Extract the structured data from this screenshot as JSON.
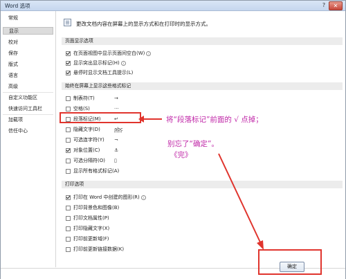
{
  "window": {
    "title": "Word 选项",
    "help_label": "?",
    "close_label": "✕"
  },
  "nav": {
    "items": [
      {
        "label": "常规"
      },
      {
        "label": "显示",
        "selected": true
      },
      {
        "label": "校对"
      },
      {
        "label": "保存"
      },
      {
        "label": "版式"
      },
      {
        "label": "语言"
      },
      {
        "label": "高级"
      },
      {
        "label": "自定义功能区"
      },
      {
        "label": "快速访问工具栏"
      },
      {
        "label": "加载项"
      },
      {
        "label": "信任中心"
      }
    ]
  },
  "main": {
    "header_icon": "document-display-icon",
    "description": "更改文档内容在屏幕上的显示方式和在打印时的显示方式。",
    "sections": {
      "page_display": {
        "title": "页面显示选项",
        "options": [
          {
            "label": "在页面视图中显示页面间空白(W)",
            "checked": true,
            "info": true
          },
          {
            "label": "显示突出显示标记(H)",
            "checked": true,
            "info": true
          },
          {
            "label": "悬停时显示文档工具提示(L)",
            "checked": true,
            "info": false
          }
        ]
      },
      "formatting_marks": {
        "title": "始终在屏幕上显示这些格式标记",
        "options": [
          {
            "label": "制表符(T)",
            "checked": false,
            "symbol": "→"
          },
          {
            "label": "空格(S)",
            "checked": false,
            "symbol": "···"
          },
          {
            "label": "段落标记(M)",
            "checked": false,
            "symbol": "↵"
          },
          {
            "label": "隐藏文字(D)",
            "checked": false,
            "symbol": "abc"
          },
          {
            "label": "可选连字符(Y)",
            "checked": false,
            "symbol": "¬"
          },
          {
            "label": "对象位置(C)",
            "checked": true,
            "symbol": "⚓"
          },
          {
            "label": "可选分隔符(O)",
            "checked": false,
            "symbol": "▯"
          },
          {
            "label": "显示所有格式标记(A)",
            "checked": false,
            "symbol": ""
          }
        ]
      },
      "print": {
        "title": "打印选项",
        "options": [
          {
            "label": "打印在 Word 中创建的图形(R)",
            "checked": true,
            "info": true
          },
          {
            "label": "打印背景色和图像(B)",
            "checked": false,
            "info": false
          },
          {
            "label": "打印文档属性(P)",
            "checked": false,
            "info": false
          },
          {
            "label": "打印隐藏文字(X)",
            "checked": false,
            "info": false
          },
          {
            "label": "打印前更新域(F)",
            "checked": false,
            "info": false
          },
          {
            "label": "打印前更新链接数据(K)",
            "checked": false,
            "info": false
          }
        ]
      }
    }
  },
  "annotations": {
    "line1": "将“段落标记”前面的 √ 点掉；",
    "line2": "别忘了“确定”。",
    "line3": "《完》",
    "color": "#c028a8",
    "highlight_color": "#e0342d"
  },
  "footer": {
    "ok_label": "确定"
  }
}
